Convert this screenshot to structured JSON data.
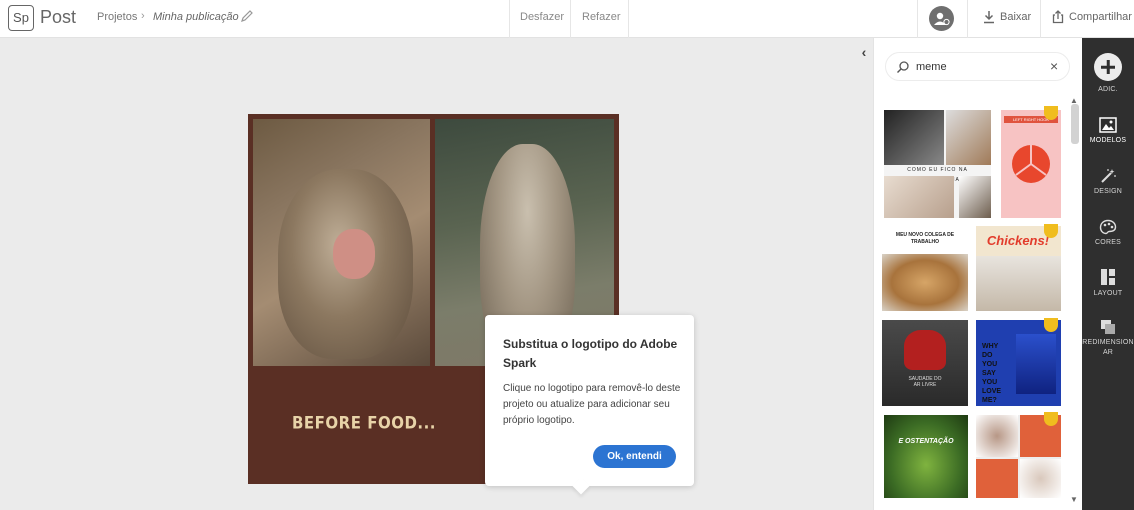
{
  "app": {
    "logo_text": "Sp",
    "name": "Post"
  },
  "breadcrumb": {
    "parent": "Projetos",
    "separator": "›",
    "current": "Minha publicação"
  },
  "toolbar": {
    "undo": "Desfazer",
    "redo": "Refazer",
    "download": "Baixar",
    "share": "Compartilhar"
  },
  "canvas": {
    "post_text": "BEFORE FOOD..."
  },
  "tooltip": {
    "title": "Substitua o logotipo do Adobe Spark",
    "body": "Clique no logotipo para removê-lo deste projeto ou atualize para adicionar seu próprio logotipo.",
    "button": "Ok, entendi"
  },
  "search": {
    "value": "meme",
    "clear": "×"
  },
  "templates": [
    {
      "caption": "COMO EU FICO NA QUARENTENA",
      "premium": false
    },
    {
      "caption": "LEFT RIGHT HOOK",
      "premium": true
    },
    {
      "caption": "MEU NOVO COLEGA DE TRABALHO",
      "premium": false
    },
    {
      "caption": "Chickens!",
      "premium": true
    },
    {
      "caption": "SAUDADE DO AR LIVRE",
      "premium": false
    },
    {
      "caption": "WHY DO YOU SAY YOU LOVE ME?",
      "premium": true
    },
    {
      "caption": "E OSTENTAÇÃO",
      "premium": false
    },
    {
      "caption": "",
      "premium": true
    }
  ],
  "sidebar": {
    "add": "ADIC.",
    "templates": "MODELOS",
    "design": "DESIGN",
    "colors": "CORES",
    "layout": "LAYOUT",
    "resize": "REDIMENSIONAR"
  },
  "colors": {
    "accent": "#2c74d2",
    "sidebar_bg": "#2f2f2f",
    "post_bg": "#5a2f24",
    "post_text": "#e8d3a8",
    "premium": "#f0bd1e"
  }
}
